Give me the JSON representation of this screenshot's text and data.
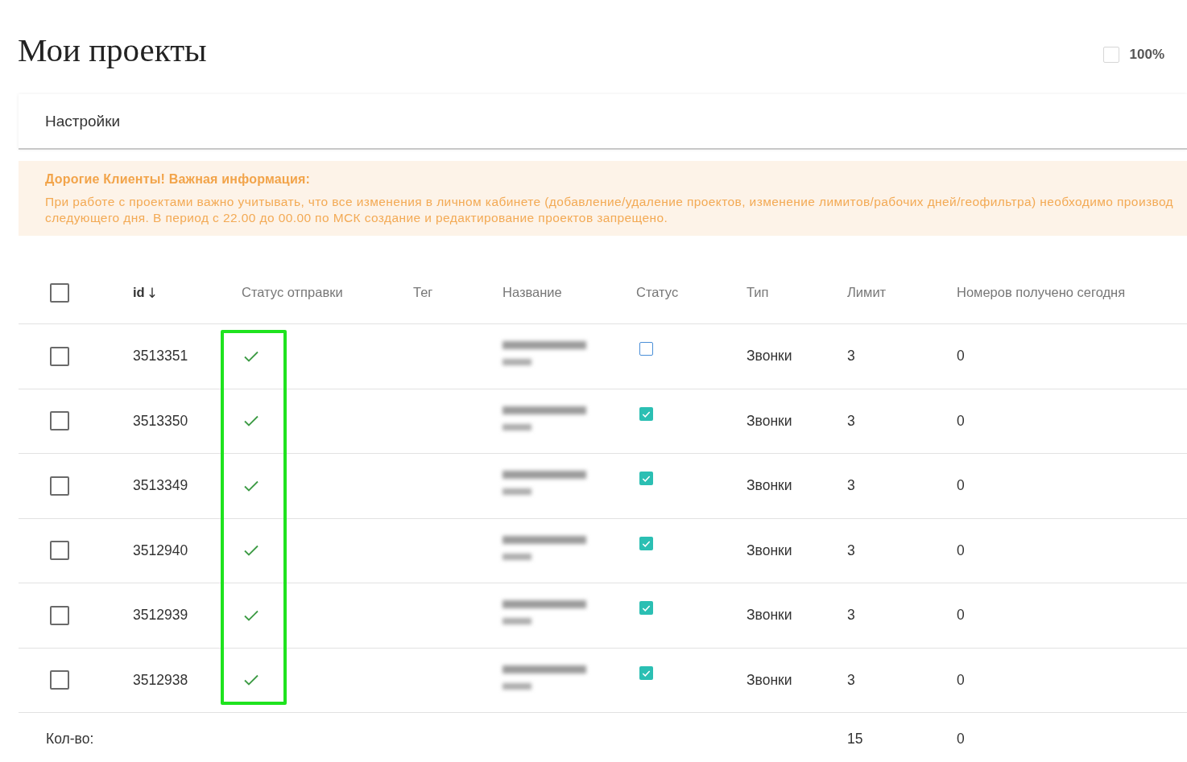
{
  "page": {
    "title": "Мои проекты",
    "zoom_toggle": {
      "label": "100%",
      "checked": false
    }
  },
  "settings": {
    "label": "Настройки"
  },
  "notice": {
    "title": "Дорогие Клиенты! Важная информация:",
    "lines": [
      "При работе с проектами важно учитывать, что все изменения в личном кабинете (добавление/удаление проектов, изменение лимитов/рабочих дней/геофильтра) необходимо производ",
      "следующего дня. В период с 22.00 до 00.00 по МСК создание и редактирование проектов запрещено."
    ]
  },
  "table": {
    "select_all": {
      "checked": false
    },
    "columns": [
      {
        "label": "id",
        "sort_arrow": "↓",
        "highlighted": false
      },
      {
        "label": "Статус отправки",
        "highlighted": true
      },
      {
        "label": "Тег",
        "highlighted": false
      },
      {
        "label": "Название",
        "highlighted": false
      },
      {
        "label": "Статус",
        "highlighted": false
      },
      {
        "label": "Тип",
        "highlighted": false
      },
      {
        "label": "Лимит",
        "highlighted": false
      },
      {
        "label": "Номеров получено сегодня",
        "highlighted": false
      }
    ],
    "rows": [
      {
        "selected": false,
        "id": "3513351",
        "sent": true,
        "active": false,
        "type": "Звонки",
        "limit": "3",
        "received_today": "0"
      },
      {
        "selected": false,
        "id": "3513350",
        "sent": true,
        "active": true,
        "type": "Звонки",
        "limit": "3",
        "received_today": "0"
      },
      {
        "selected": false,
        "id": "3513349",
        "sent": true,
        "active": true,
        "type": "Звонки",
        "limit": "3",
        "received_today": "0"
      },
      {
        "selected": false,
        "id": "3512940",
        "sent": true,
        "active": true,
        "type": "Звонки",
        "limit": "3",
        "received_today": "0"
      },
      {
        "selected": false,
        "id": "3512939",
        "sent": true,
        "active": true,
        "type": "Звонки",
        "limit": "3",
        "received_today": "0"
      },
      {
        "selected": false,
        "id": "3512938",
        "sent": true,
        "active": true,
        "type": "Звонки",
        "limit": "3",
        "received_today": "0"
      }
    ],
    "footer": {
      "label": "Кол-во:",
      "limit_total": "15",
      "received_total": "0"
    }
  }
}
